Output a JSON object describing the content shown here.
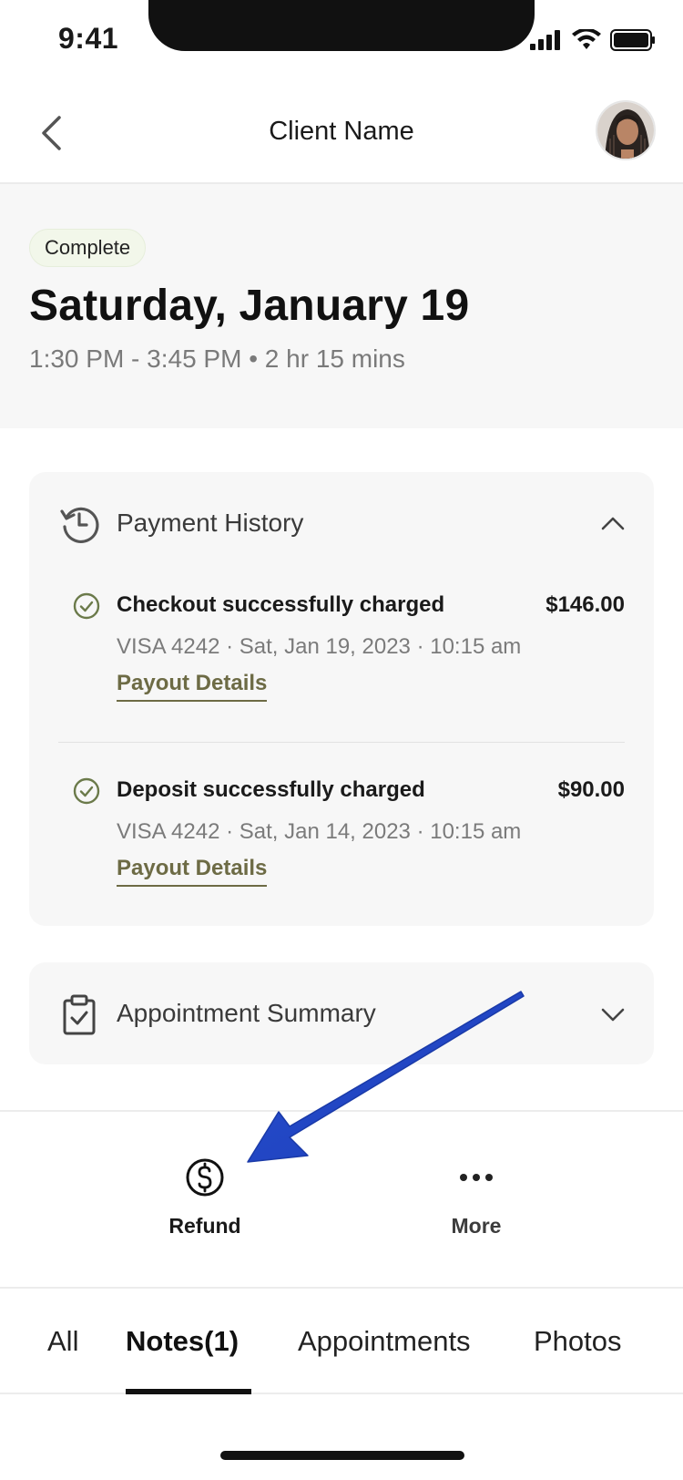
{
  "status_bar": {
    "time": "9:41",
    "icons": [
      "signal-icon",
      "wifi-icon",
      "battery-icon"
    ]
  },
  "header": {
    "back_icon": "chevron-left-icon",
    "title": "Client Name",
    "avatar": "client-avatar"
  },
  "appointment": {
    "status": "Complete",
    "date": "Saturday, January 19",
    "time_range": "1:30 PM - 3:45 PM • 2 hr 15 mins"
  },
  "payment_history": {
    "title": "Payment History",
    "icon": "history-clock-icon",
    "expanded": true,
    "transactions": [
      {
        "title": "Checkout successfully charged",
        "amount": "$146.00",
        "meta": "VISA 4242 · Sat, Jan 19, 2023 · 10:15 am",
        "link": "Payout Details"
      },
      {
        "title": "Deposit successfully charged",
        "amount": "$90.00",
        "meta": "VISA 4242 · Sat, Jan 14, 2023 · 10:15 am",
        "link": "Payout Details"
      }
    ]
  },
  "appointment_summary": {
    "title": "Appointment Summary",
    "icon": "clipboard-check-icon",
    "expanded": false
  },
  "actions": [
    {
      "label": "Refund",
      "icon": "dollar-circle-icon"
    },
    {
      "label": "More",
      "icon": "ellipsis-icon"
    }
  ],
  "tabs": [
    {
      "label": "All",
      "active": false
    },
    {
      "label": "Notes(1)",
      "active": true
    },
    {
      "label": "Appointments",
      "active": false
    },
    {
      "label": "Photos",
      "active": false
    }
  ],
  "colors": {
    "accent_link": "#6d6b45",
    "success_check": "#6b7a4a",
    "badge_bg": "#f2f7ea",
    "annotation_arrow": "#1a3fb8",
    "surface": "#f7f7f7"
  }
}
